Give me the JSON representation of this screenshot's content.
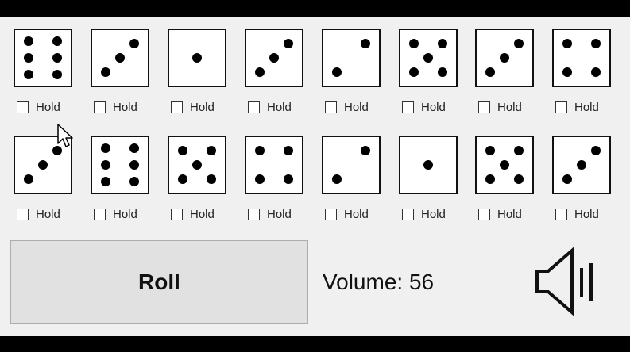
{
  "dice": [
    {
      "value": 6,
      "hold_label": "Hold",
      "held": false
    },
    {
      "value": 3,
      "hold_label": "Hold",
      "held": false
    },
    {
      "value": 1,
      "hold_label": "Hold",
      "held": false
    },
    {
      "value": 3,
      "hold_label": "Hold",
      "held": false
    },
    {
      "value": 2,
      "hold_label": "Hold",
      "held": false
    },
    {
      "value": 5,
      "hold_label": "Hold",
      "held": false
    },
    {
      "value": 3,
      "hold_label": "Hold",
      "held": false
    },
    {
      "value": 4,
      "hold_label": "Hold",
      "held": false
    },
    {
      "value": 3,
      "hold_label": "Hold",
      "held": false
    },
    {
      "value": 6,
      "hold_label": "Hold",
      "held": false
    },
    {
      "value": 5,
      "hold_label": "Hold",
      "held": false
    },
    {
      "value": 4,
      "hold_label": "Hold",
      "held": false
    },
    {
      "value": 2,
      "hold_label": "Hold",
      "held": false
    },
    {
      "value": 1,
      "hold_label": "Hold",
      "held": false
    },
    {
      "value": 5,
      "hold_label": "Hold",
      "held": false
    },
    {
      "value": 3,
      "hold_label": "Hold",
      "held": false
    }
  ],
  "roll_button": {
    "label": "Roll"
  },
  "volume": {
    "label": "Volume: 56",
    "level": 56
  },
  "icons": {
    "speaker": "speaker-volume-icon",
    "cursor": "mouse-pointer-icon"
  }
}
